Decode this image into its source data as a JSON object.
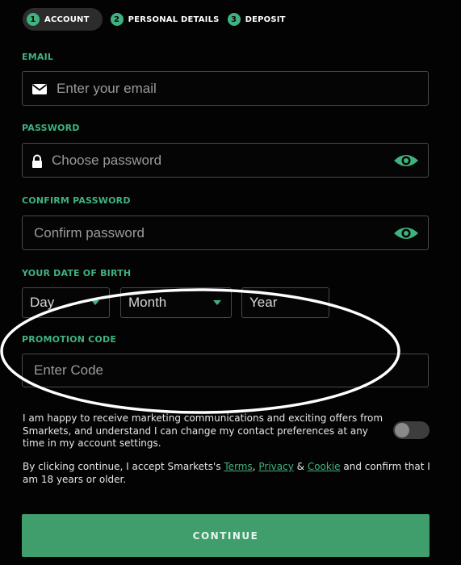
{
  "steps": [
    {
      "number": "1",
      "label": "ACCOUNT"
    },
    {
      "number": "2",
      "label": "PERSONAL DETAILS"
    },
    {
      "number": "3",
      "label": "DEPOSIT"
    }
  ],
  "email": {
    "label": "EMAIL",
    "placeholder": "Enter your email",
    "icon": "envelope-icon"
  },
  "password": {
    "label": "PASSWORD",
    "placeholder": "Choose password",
    "icon": "lock-icon",
    "toggle_icon": "eye-icon"
  },
  "confirm_password": {
    "label": "CONFIRM PASSWORD",
    "placeholder": "Confirm password",
    "toggle_icon": "eye-icon"
  },
  "dob": {
    "label": "YOUR DATE OF BIRTH",
    "day": "Day",
    "month": "Month",
    "year": "Year"
  },
  "promo": {
    "label": "PROMOTION CODE",
    "placeholder": "Enter Code"
  },
  "consent": {
    "text": "I am happy to receive marketing communications and exciting offers from Smarkets, and understand I can change my contact preferences at any time in my account settings.",
    "toggle_on": false
  },
  "terms": {
    "prefix": "By clicking continue, I accept Smarkets's ",
    "terms_link": "Terms",
    "sep1": ", ",
    "privacy_link": "Privacy",
    "sep2": " & ",
    "cookie_link": "Cookie",
    "suffix": " and confirm that I am 18 years or older."
  },
  "continue_label": "CONTINUE",
  "colors": {
    "accent": "#3fb27f",
    "button": "#3f9e6b",
    "background": "#030303"
  }
}
